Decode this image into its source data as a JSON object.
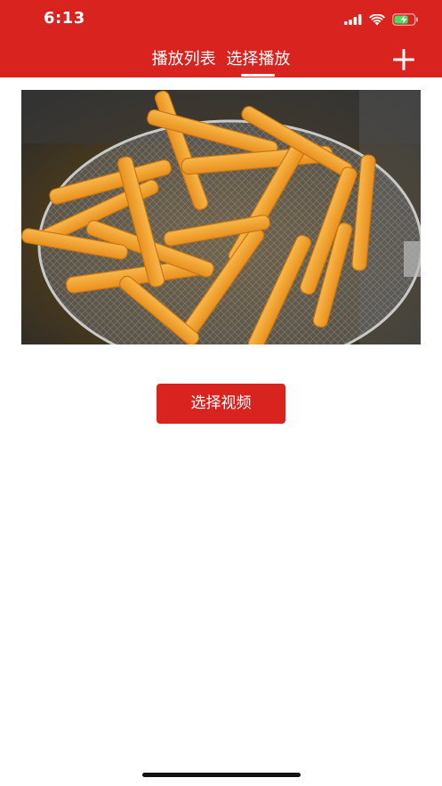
{
  "status_bar": {
    "time": "6:13",
    "icons": [
      "signal-icon",
      "wifi-icon",
      "battery-charging-icon"
    ]
  },
  "nav": {
    "tabs": [
      {
        "label": "播放列表",
        "active": false
      },
      {
        "label": "选择播放",
        "active": true
      }
    ],
    "add_icon": "plus-icon"
  },
  "preview": {
    "description_icon": "video-thumbnail"
  },
  "main": {
    "select_video_label": "选择视频"
  },
  "colors": {
    "brand": "#d8231f",
    "background": "#ffffff",
    "text_on_brand": "#ffffff"
  }
}
